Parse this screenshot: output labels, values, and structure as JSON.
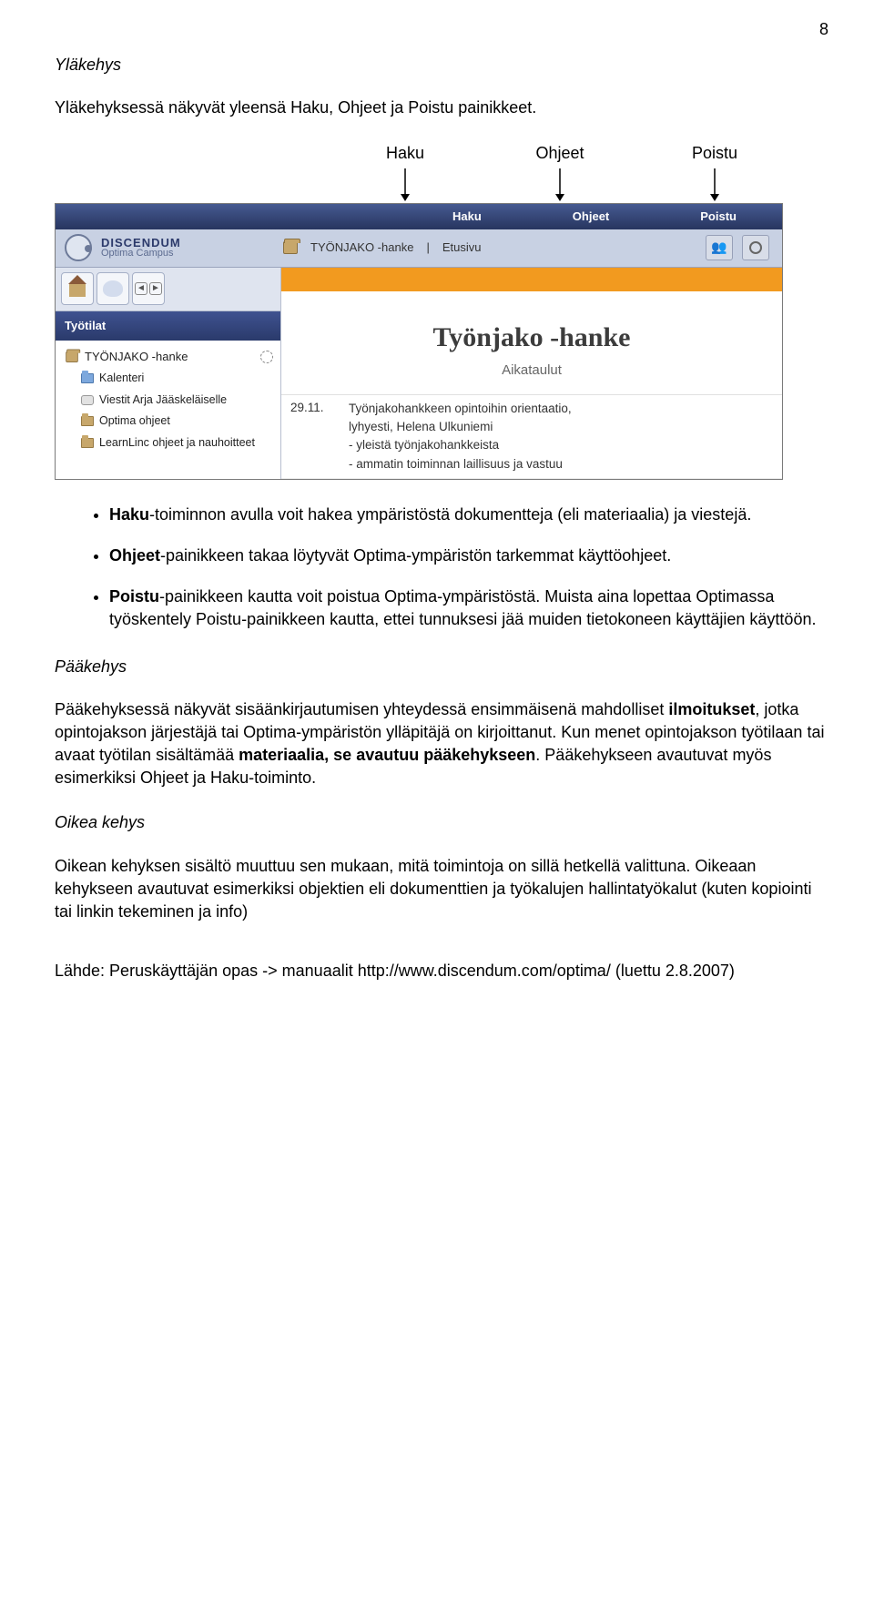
{
  "page_number": "8",
  "sections": {
    "ylakehys": {
      "title": "Yläkehys",
      "intro": "Yläkehyksessä näkyvät yleensä Haku, Ohjeet ja Poistu painikkeet.",
      "labels": {
        "haku": "Haku",
        "ohjeet": "Ohjeet",
        "poistu": "Poistu"
      }
    },
    "bullets": {
      "b1_prefix": "Haku",
      "b1_rest": "-toiminnon avulla voit hakea ympäristöstä dokumentteja (eli materiaalia) ja viestejä.",
      "b2_prefix": "Ohjeet",
      "b2_rest": "-painikkeen takaa löytyvät Optima-ympäristön tarkemmat käyttöohjeet.",
      "b3_prefix": "Poistu",
      "b3_rest": "-painikkeen kautta voit poistua Optima-ympäristöstä. Muista aina lopettaa Optimassa työskentely Poistu-painikkeen kautta, ettei tunnuksesi jää muiden tietokoneen käyttäjien käyttöön."
    },
    "paakehys": {
      "title": "Pääkehys",
      "para_pre": "Pääkehyksessä näkyvät sisäänkirjautumisen yhteydessä ensimmäisenä mahdolliset ",
      "bold1": "ilmoitukset",
      "mid1": ", jotka opintojakson järjestäjä tai Optima-ympäristön ylläpitäjä on kirjoittanut. Kun menet opintojakson työtilaan tai avaat työtilan sisältämää ",
      "bold2": "materiaalia, se avautuu pääkehykseen",
      "tail": ". Pääkehykseen avautuvat myös esimerkiksi Ohjeet ja Haku-toiminto."
    },
    "oikea": {
      "title": "Oikea kehys",
      "para": "Oikean kehyksen sisältö muuttuu sen mukaan, mitä toimintoja on sillä hetkellä valittuna. Oikeaan kehykseen avautuvat esimerkiksi objektien eli dokumenttien ja työkalujen hallintatyökalut (kuten kopiointi tai linkin tekeminen ja info)"
    },
    "source": "Lähde: Peruskäyttäjän opas -> manuaalit http://www.discendum.com/optima/  (luettu 2.8.2007)"
  },
  "screenshot": {
    "topbar": {
      "haku": "Haku",
      "ohjeet": "Ohjeet",
      "poistu": "Poistu"
    },
    "logo": {
      "line1": "DISCENDUM",
      "line2": "Optima Campus"
    },
    "breadcrumb": {
      "item1": "TYÖNJAKO -hanke",
      "sep": "|",
      "item2": "Etusivu"
    },
    "sidebar": {
      "header": "Työtilat",
      "items": [
        "TYÖNJAKO -hanke",
        "Kalenteri",
        "Viestit Arja Jääskeläiselle",
        "Optima ohjeet",
        "LearnLinc ohjeet ja nauhoitteet"
      ]
    },
    "main": {
      "title": "Työnjako -hanke",
      "subtitle": "Aikataulut",
      "rows": [
        {
          "date": "29.11.",
          "lines": [
            "Työnjakohankkeen opintoihin orientaatio,",
            "lyhyesti, Helena Ulkuniemi",
            "- yleistä työnjakohankkeista",
            "- ammatin toiminnan laillisuus ja vastuu"
          ]
        }
      ]
    }
  }
}
